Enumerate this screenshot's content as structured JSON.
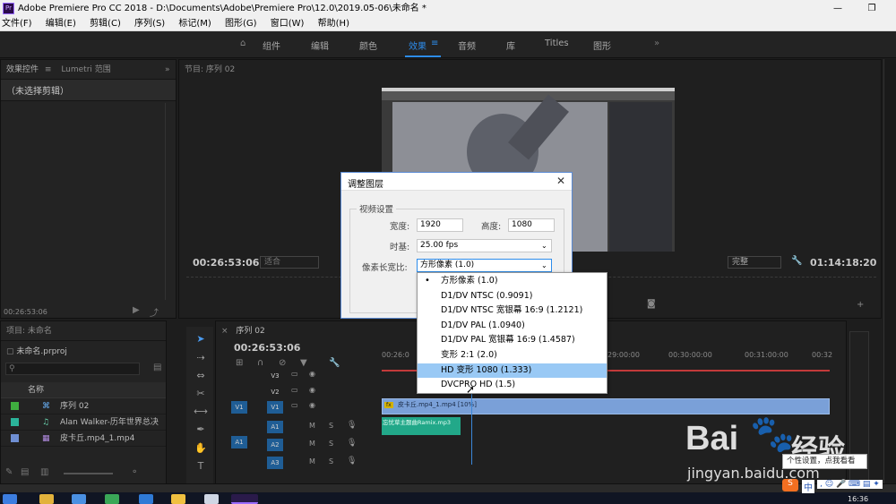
{
  "window": {
    "title": "Adobe Premiere Pro CC 2018 - D:\\Documents\\Adobe\\Premiere Pro\\12.0\\2019.05-06\\未命名 *"
  },
  "menu": [
    "文件(F)",
    "编辑(E)",
    "剪辑(C)",
    "序列(S)",
    "标记(M)",
    "图形(G)",
    "窗口(W)",
    "帮助(H)"
  ],
  "workspaces": [
    "组件",
    "编辑",
    "颜色",
    "效果",
    "音频",
    "库",
    "Titles",
    "图形"
  ],
  "workspace_active": "效果",
  "effects_panel": {
    "tabs": [
      "效果控件",
      "Lumetri 范围"
    ],
    "empty_text": "（未选择剪辑）",
    "timecode": "00:26:53:06"
  },
  "program_monitor": {
    "tab": "节目: 序列 02",
    "timecode_left": "00:26:53:06",
    "fit_select": "适合",
    "quality_select": "完整",
    "timecode_right": "01:14:18:20"
  },
  "dialog": {
    "title": "调整图层",
    "group": "视频设置",
    "width_label": "宽度:",
    "width_value": "1920",
    "height_label": "高度:",
    "height_value": "1080",
    "timebase_label": "时基:",
    "timebase_value": "25.00 fps",
    "pixel_aspect_label": "像素长宽比:",
    "pixel_aspect_value": "方形像素 (1.0)"
  },
  "pixel_aspect_options": [
    {
      "label": "方形像素 (1.0)",
      "checked": true
    },
    {
      "label": "D1/DV NTSC (0.9091)"
    },
    {
      "label": "D1/DV NTSC 宽银幕 16:9 (1.2121)"
    },
    {
      "label": "D1/DV PAL (1.0940)"
    },
    {
      "label": "D1/DV PAL 宽银幕 16:9 (1.4587)"
    },
    {
      "label": "变形 2:1 (2.0)"
    },
    {
      "label": "HD 变形 1080 (1.333)",
      "highlighted": true
    },
    {
      "label": "DVCPRO HD (1.5)"
    }
  ],
  "project_panel": {
    "tab": "项目: 未命名",
    "project_file": "未命名.prproj",
    "column_name": "名称",
    "items": [
      {
        "name": "序列 02",
        "color": "#3fae3f"
      },
      {
        "name": "Alan Walker-历年世界总决",
        "color": "#2bb39a"
      },
      {
        "name": "皮卡丘.mp4_1.mp4",
        "color": "#6f8fd3"
      }
    ]
  },
  "timeline": {
    "tab": "序列 02",
    "timecode": "00:26:53:06",
    "ruler_labels": [
      "00:26:0",
      "29:00:00",
      "00:30:00:00",
      "00:31:00:00",
      "00:32"
    ],
    "video_tracks": [
      "V3",
      "V2",
      "V1"
    ],
    "audio_tracks": [
      "A1",
      "A2",
      "A3"
    ],
    "source_v": "V1",
    "source_a": "A1",
    "video_clip": "皮卡丘.mp4_1.mp4 [10%]",
    "audio_clip": "忘忧草主题曲Ramix.mp3"
  },
  "watermark": {
    "brand": "Bai",
    "brand_cn": "经验",
    "url": "jingyan.baidu.com",
    "tooltip": "个性设置，点我看看"
  },
  "taskbar": {
    "time": "16:36",
    "ime": "中"
  },
  "colors": {
    "accent_blue": "#2d8ceb",
    "highlight": "#99c9f5",
    "clip_video": "#7aa0d8",
    "clip_audio": "#22a889",
    "playhead": "#3b87d8"
  }
}
